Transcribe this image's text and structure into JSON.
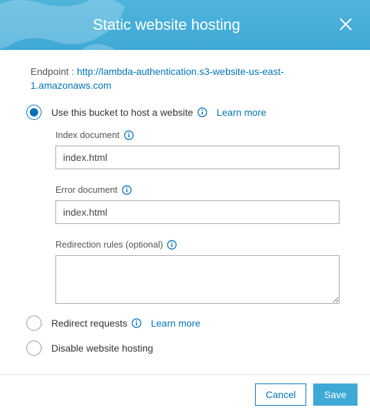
{
  "header": {
    "title": "Static website hosting"
  },
  "endpoint": {
    "label": "Endpoint : ",
    "url": "http://lambda-authentication.s3-website-us-east-1.amazonaws.com"
  },
  "options": {
    "host": {
      "label": "Use this bucket to host a website",
      "learn_more": "Learn more",
      "selected": true,
      "index_doc_label": "Index document",
      "index_doc_value": "index.html",
      "error_doc_label": "Error document",
      "error_doc_value": "index.html",
      "redirect_rules_label": "Redirection rules (optional)",
      "redirect_rules_value": ""
    },
    "redirect": {
      "label": "Redirect requests",
      "learn_more": "Learn more",
      "selected": false
    },
    "disable": {
      "label": "Disable website hosting",
      "selected": false
    }
  },
  "buttons": {
    "cancel": "Cancel",
    "save": "Save"
  }
}
